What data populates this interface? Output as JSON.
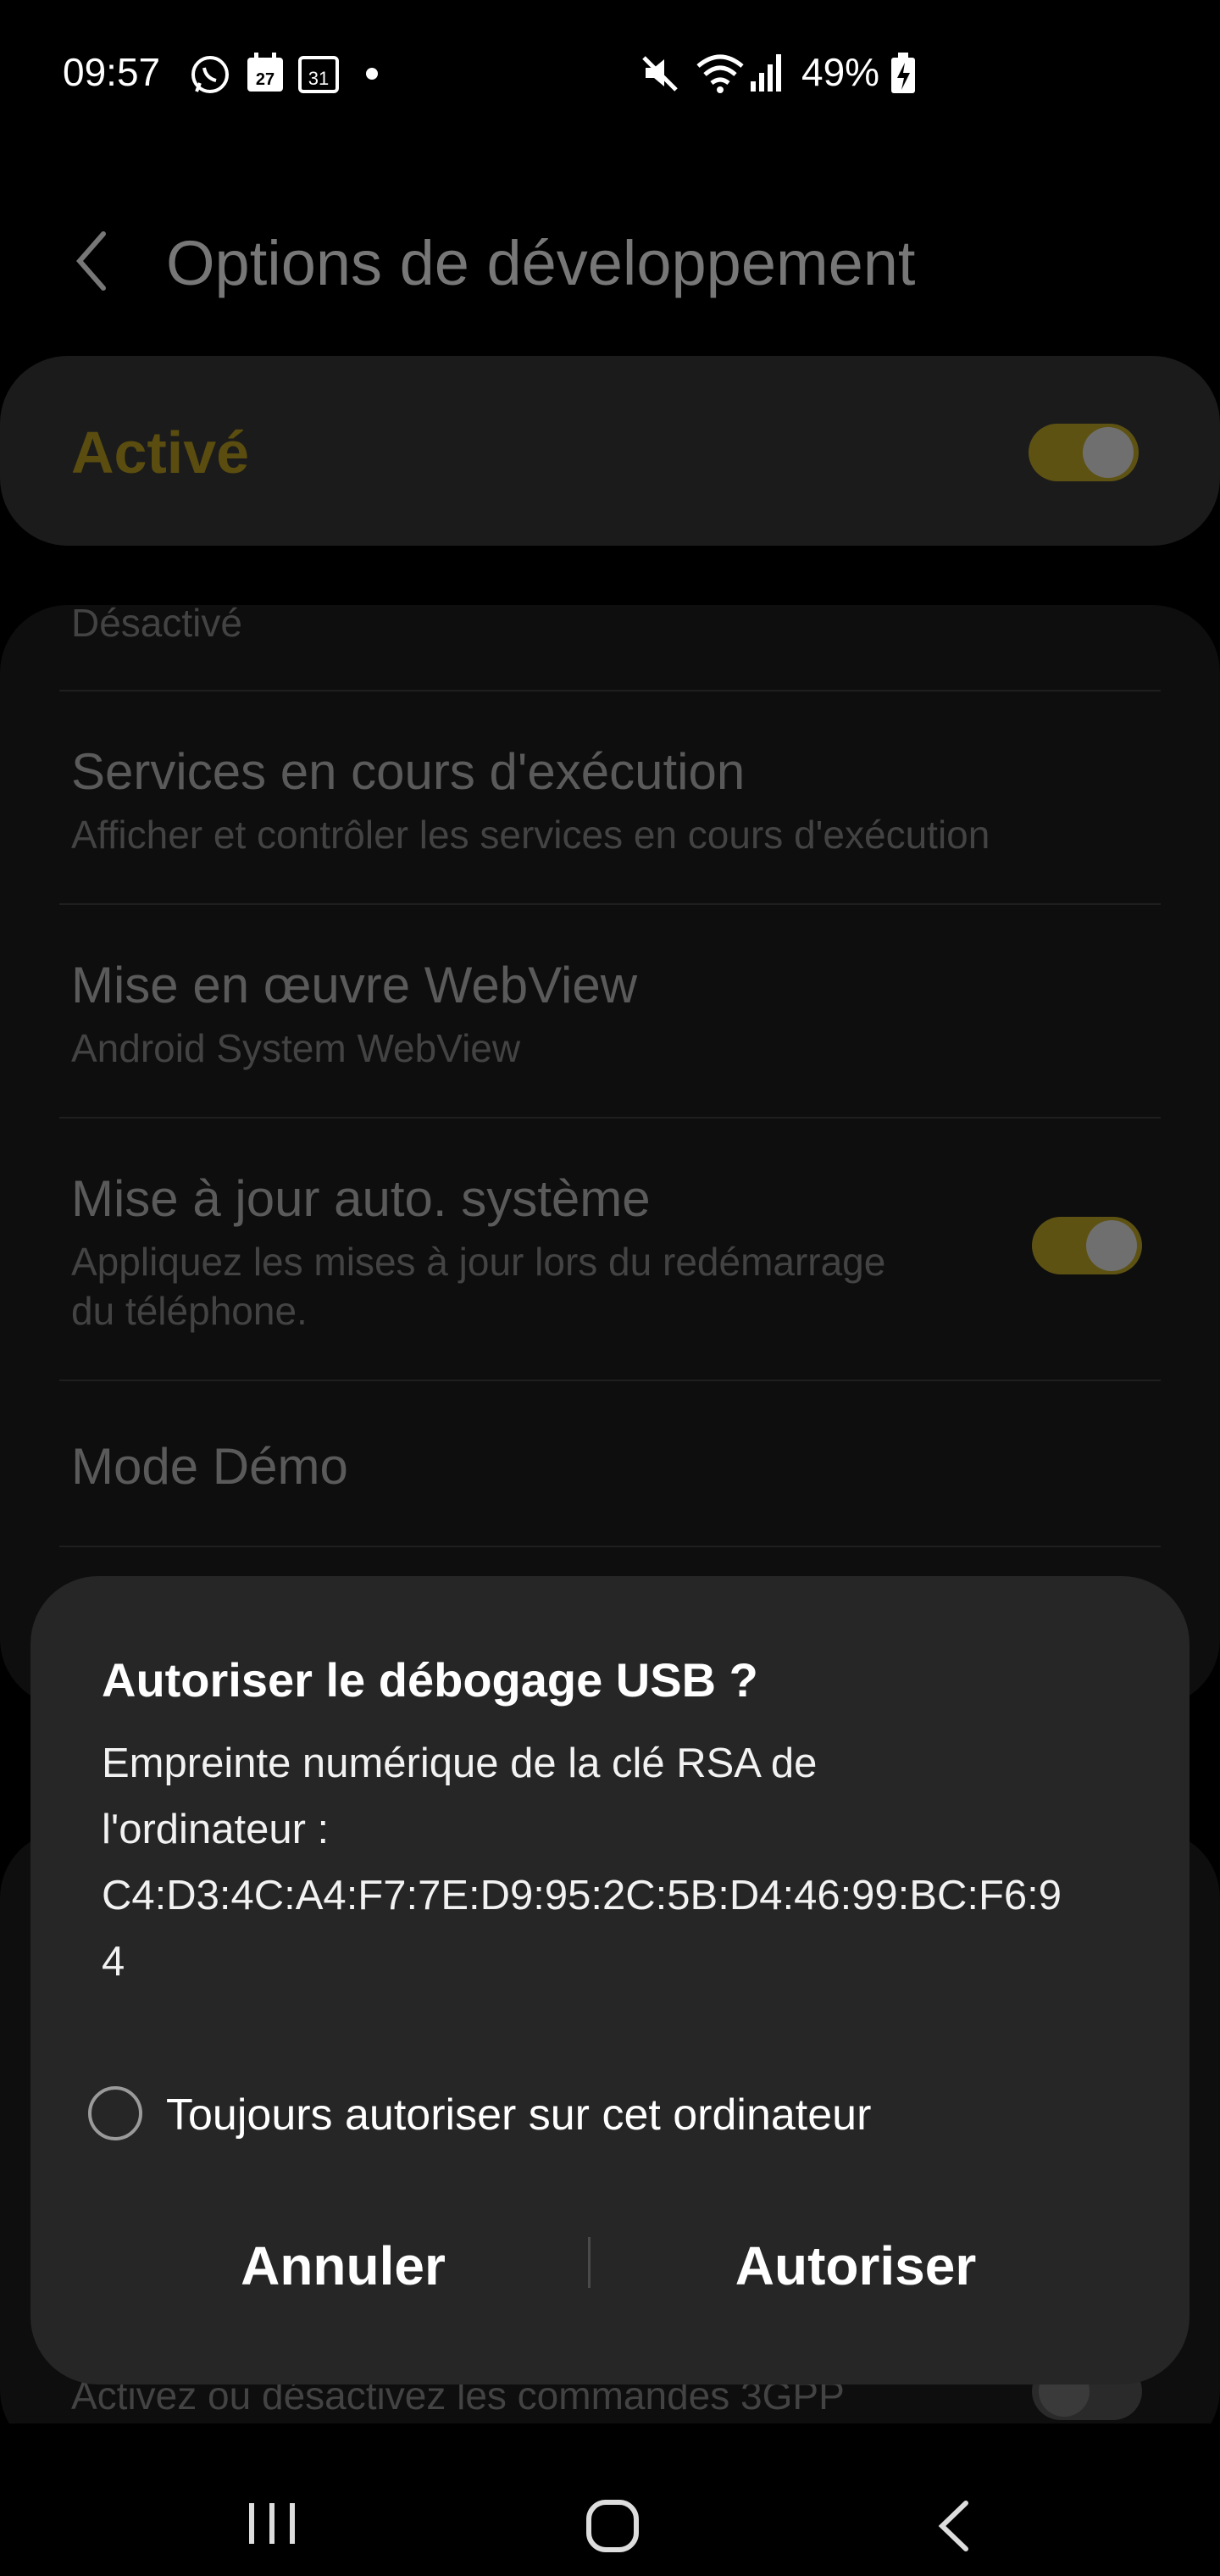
{
  "status_bar": {
    "time": "09:57",
    "notification_icons": [
      "whatsapp-icon",
      "calendar-27-icon",
      "calendar-31-icon",
      "dot-icon"
    ],
    "calendar_day_1": "27",
    "calendar_day_2": "31",
    "battery": "49%",
    "system_icons": [
      "mute-icon",
      "wifi-icon",
      "signal-icon",
      "battery-charging-icon"
    ]
  },
  "header": {
    "title": "Options de développement"
  },
  "master_switch": {
    "label": "Activé",
    "on": true
  },
  "settings": {
    "partial_item": "Désactivé",
    "items": [
      {
        "title": "Services en cours d'exécution",
        "subtitle": "Afficher et contrôler les services en cours d'exécution"
      },
      {
        "title": "Mise en œuvre WebView",
        "subtitle": "Android System WebView"
      },
      {
        "title": "Mise à jour auto. système",
        "subtitle_line1": "Appliquez les mises à jour lors du redémarrage",
        "subtitle_line2": "du téléphone.",
        "toggle_on": true
      },
      {
        "title": "Mode Démo"
      }
    ],
    "bottom_partial_subtitle": "Activez ou désactivez les commandes 3GPP",
    "bottom_toggle_on": false
  },
  "dialog": {
    "title": "Autoriser le débogage USB ?",
    "body_line1": "Empreinte numérique de la clé RSA de",
    "body_line2": "l'ordinateur :",
    "body_line3": "C4:D3:4C:A4:F7:7E:D9:95:2C:5B:D4:46:99:BC:F6:9",
    "body_line4": "4",
    "always_allow_label": "Toujours autoriser sur cet ordinateur",
    "always_allow_checked": false,
    "cancel_label": "Annuler",
    "allow_label": "Autoriser"
  },
  "nav_bar": {
    "buttons": [
      "recents-icon",
      "home-icon",
      "back-icon"
    ]
  },
  "colors": {
    "accent_dim": "#5e5213",
    "dialog_bg": "#262626",
    "page_bg": "#000000"
  }
}
